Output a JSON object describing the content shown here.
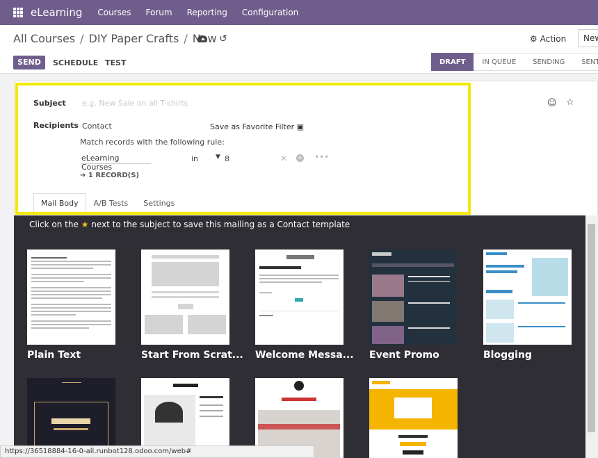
{
  "navbar": {
    "app_name": "eLearning",
    "menu": [
      "Courses",
      "Forum",
      "Reporting",
      "Configuration"
    ]
  },
  "breadcrumb": {
    "items": [
      "All Courses",
      "DIY Paper Crafts",
      "New"
    ]
  },
  "toolbar": {
    "action_label": "Action",
    "new_label": "New",
    "send_label": "SEND",
    "schedule_label": "SCHEDULE",
    "test_label": "TEST"
  },
  "statusbar": {
    "stages": [
      "DRAFT",
      "IN QUEUE",
      "SENDING",
      "SENT"
    ],
    "active": "DRAFT"
  },
  "form": {
    "subject_label": "Subject",
    "subject_placeholder": "e.g. New Sale on all T-shirts",
    "recipients_label": "Recipients",
    "recipients_model": "Contact",
    "save_favorite": "Save as Favorite Filter",
    "rule_text": "Match records with the following rule:",
    "rule_field": "eLearning Courses",
    "rule_operator": "in",
    "rule_value": "8",
    "records_count": "1 RECORD(S)"
  },
  "tabs": [
    "Mail Body",
    "A/B Tests",
    "Settings"
  ],
  "templates_panel": {
    "hint_before": "Click on the",
    "hint_after": "next to the subject to save this mailing as a Contact template",
    "templates": [
      "Plain Text",
      "Start From Scrat...",
      "Welcome Messa...",
      "Event Promo",
      "Blogging"
    ]
  },
  "status_url": "https://36518884-16-0-all.runbot128.odoo.com/web#",
  "colors": {
    "brand": "#6f5e8c",
    "highlight": "#f3ea00",
    "panel_bg": "#2f2e35"
  }
}
